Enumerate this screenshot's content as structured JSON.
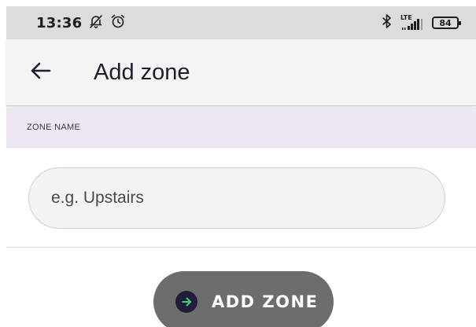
{
  "status_bar": {
    "time": "13:36",
    "lte_label": "LTE",
    "battery_level": "84"
  },
  "app_bar": {
    "title": "Add zone"
  },
  "section": {
    "label": "ZONE NAME"
  },
  "zone_input": {
    "value": "",
    "placeholder": "e.g. Upstairs"
  },
  "add_button": {
    "label": "ADD ZONE"
  },
  "colors": {
    "status_bar_bg": "#dcdcdc",
    "app_bar_bg": "#f4f4f4",
    "section_header_bg": "#ece7f3",
    "button_bg": "#6d6d6d",
    "button_icon_bg": "#1f1d3a",
    "button_icon_arrow": "#39d36b"
  },
  "icons": {
    "status_left": [
      "notifications-off-icon",
      "alarm-icon"
    ],
    "status_right": [
      "bluetooth-icon",
      "lte-signal-icon",
      "battery-icon"
    ],
    "back": "arrow-back-icon",
    "add": "arrow-right-circle-icon"
  }
}
